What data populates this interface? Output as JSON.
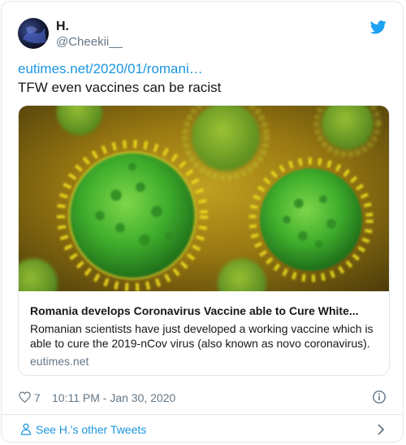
{
  "user": {
    "display_name": "H.",
    "handle": "@Cheekii__"
  },
  "tweet": {
    "link_text": "eutimes.net/2020/01/romani…",
    "text": "TFW even vaccines can be racist"
  },
  "card": {
    "title": "Romania develops Coronavirus Vaccine able to Cure White...",
    "description": "Romanian scientists have just developed a working vaccine which is able to cure the 2019-nCov virus (also known as novo coronavirus).",
    "domain": "eutimes.net",
    "image": "coronavirus-illustration"
  },
  "footer": {
    "like_count": "7",
    "timestamp": "10:11 PM - Jan 30, 2020"
  },
  "more": {
    "label": "See H.'s other Tweets"
  },
  "colors": {
    "accent": "#1b95e0",
    "secondary_text": "#657786",
    "border": "#e1e8ed"
  },
  "icons": [
    "twitter-bird-icon",
    "heart-icon",
    "info-icon",
    "person-icon",
    "chevron-right-icon"
  ]
}
